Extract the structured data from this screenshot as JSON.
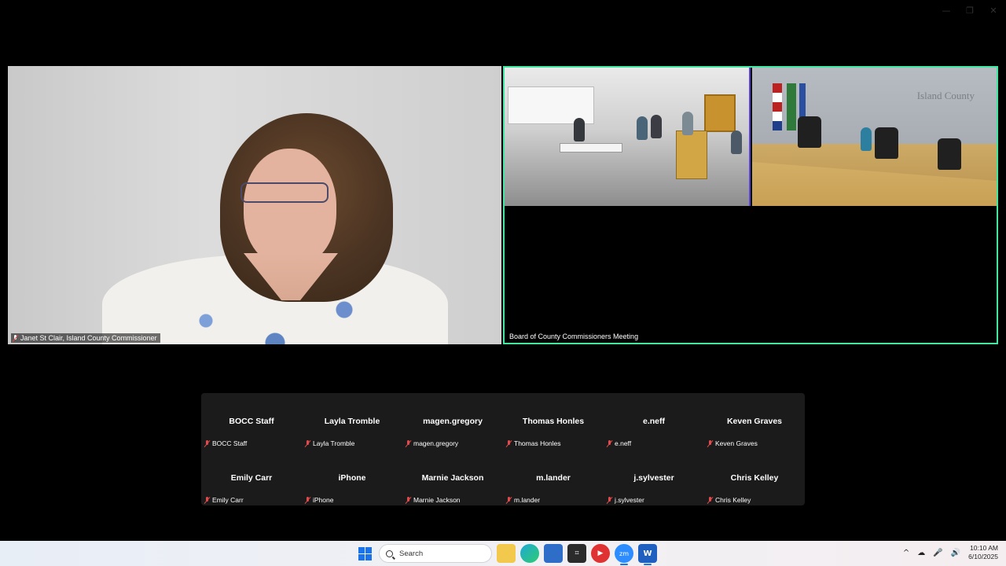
{
  "window": {
    "controls": [
      "—",
      "❐",
      "✕"
    ]
  },
  "speaker_tile": {
    "name": "Janet St Clair, Island County Commissioner"
  },
  "room_tile": {
    "name": "Board of County Commissioners Meeting",
    "dais_sign": "Island County",
    "border_color": "#3fe7a3"
  },
  "participants": [
    {
      "display": "BOCC Staff",
      "tag": "BOCC Staff"
    },
    {
      "display": "Layla Tromble",
      "tag": "Layla Tromble"
    },
    {
      "display": "magen.gregory",
      "tag": "magen.gregory"
    },
    {
      "display": "Thomas Honles",
      "tag": "Thomas Honles"
    },
    {
      "display": "e.neff",
      "tag": "e.neff"
    },
    {
      "display": "Keven Graves",
      "tag": "Keven Graves"
    },
    {
      "display": "Emily Carr",
      "tag": "Emily Carr"
    },
    {
      "display": "iPhone",
      "tag": "iPhone"
    },
    {
      "display": "Marnie Jackson",
      "tag": "Marnie Jackson"
    },
    {
      "display": "m.lander",
      "tag": "m.lander"
    },
    {
      "display": "j.sylvester",
      "tag": "j.sylvester"
    },
    {
      "display": "Chris Kelley",
      "tag": "Chris Kelley"
    }
  ],
  "taskbar": {
    "search_placeholder": "Search",
    "apps": [
      "file-explorer-icon",
      "edge-icon",
      "store-icon",
      "vscode-icon",
      "media-icon",
      "zoom-icon",
      "word-icon"
    ],
    "tray_icons": [
      "^",
      "☁",
      "🎤",
      "🔊"
    ],
    "time": "10:10 AM",
    "date": "6/10/2025"
  }
}
